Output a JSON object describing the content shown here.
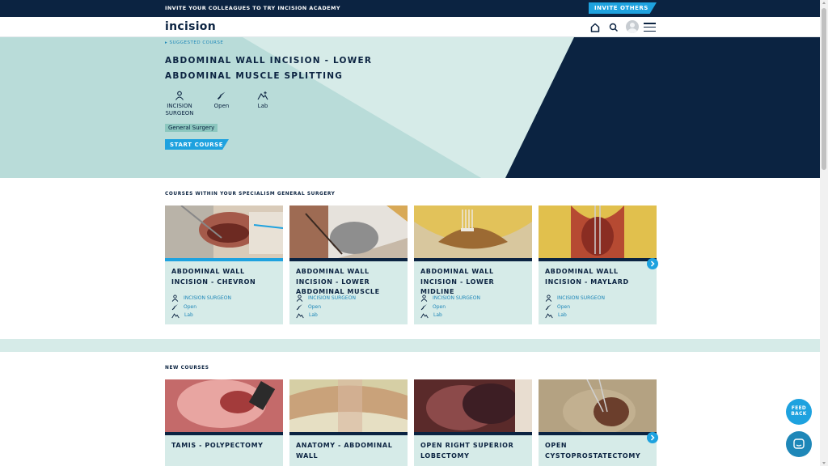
{
  "promo": {
    "text": "INVITE YOUR COLLEAGUES TO TRY INCISION ACADEMY",
    "invite_label": "INVITE OTHERS"
  },
  "header": {
    "logo": "incision",
    "icons": [
      "home-icon",
      "search-icon",
      "avatar",
      "menu-icon"
    ]
  },
  "hero": {
    "suggested_label": "SUGGESTED COURSE",
    "title": "ABDOMINAL WALL INCISION - LOWER ABDOMINAL MUSCLE SPLITTING",
    "meta": [
      {
        "icon": "surgeon-icon",
        "label": "INCISION SURGEON"
      },
      {
        "icon": "scalpel-icon",
        "label": "Open"
      },
      {
        "icon": "lab-icon",
        "label": "Lab"
      }
    ],
    "tag": "General Surgery",
    "start_label": "START COURSE"
  },
  "specialism": {
    "title": "COURSES WITHIN YOUR SPECIALISM GENERAL SURGERY",
    "cards": [
      {
        "title": "ABDOMINAL WALL INCISION - CHEVRON",
        "level": "INCISION SURGEON",
        "approach": "Open",
        "setting": "Lab"
      },
      {
        "title": "ABDOMINAL WALL INCISION - LOWER ABDOMINAL MUSCLE",
        "level": "INCISION SURGEON",
        "approach": "Open",
        "setting": "Lab"
      },
      {
        "title": "ABDOMINAL WALL INCISION - LOWER MIDLINE",
        "level": "INCISION SURGEON",
        "approach": "Open",
        "setting": "Lab"
      },
      {
        "title": "ABDOMINAL WALL INCISION - MAYLARD",
        "level": "INCISION SURGEON",
        "approach": "Open",
        "setting": "Lab"
      }
    ]
  },
  "new_courses": {
    "title": "NEW COURSES",
    "cards": [
      {
        "title": "TAMIS - POLYPECTOMY"
      },
      {
        "title": "ANATOMY - ABDOMINAL WALL"
      },
      {
        "title": "OPEN RIGHT SUPERIOR LOBECTOMY"
      },
      {
        "title": "OPEN CYSTOPROSTATECTOMY"
      }
    ]
  },
  "floating": {
    "feedback_label": "FEED BACK"
  },
  "colors": {
    "navy": "#0b2341",
    "accent": "#1ea2df",
    "mint": "#d6ebe8"
  }
}
